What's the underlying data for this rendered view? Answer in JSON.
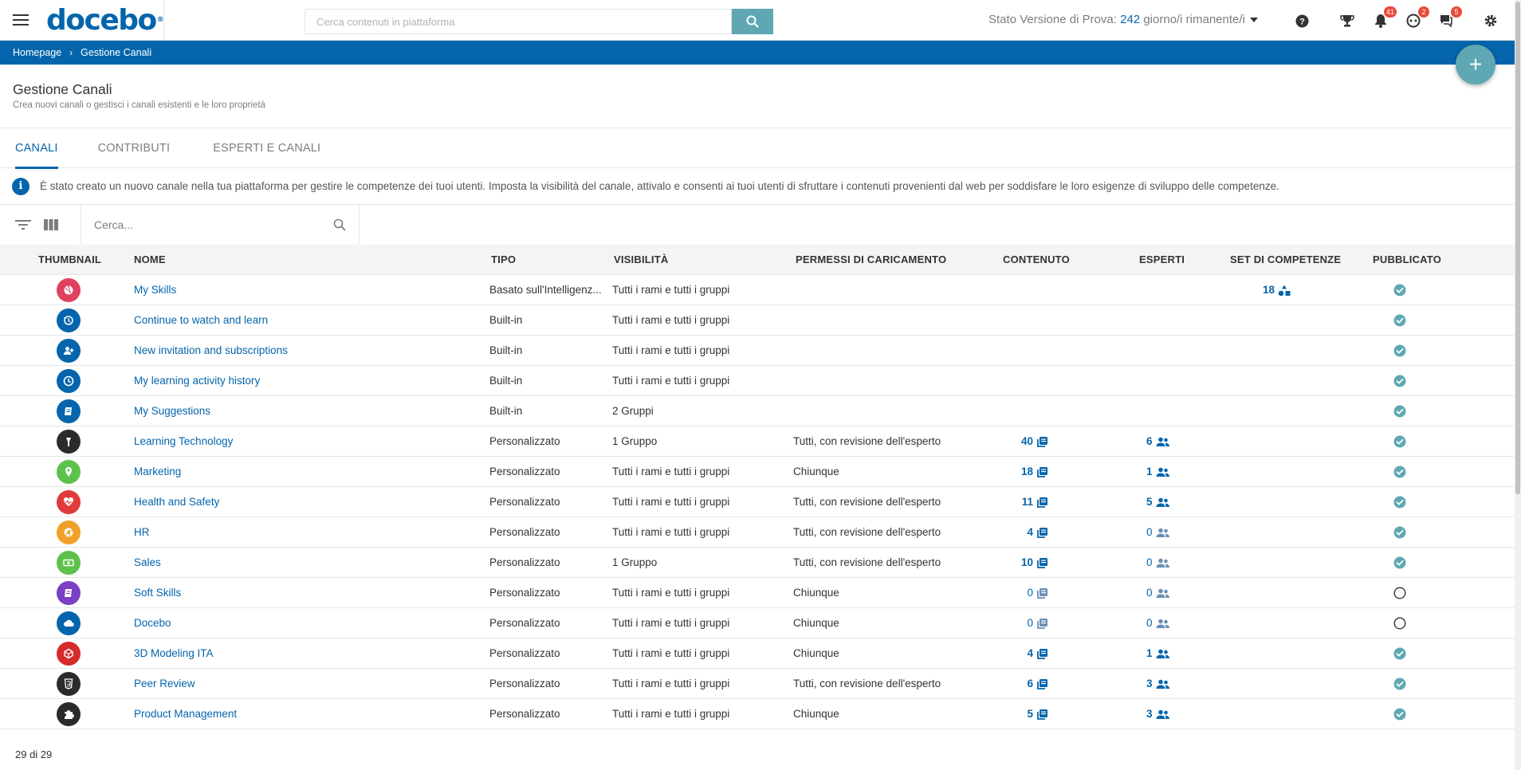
{
  "topbar": {
    "logo": "docebo",
    "search_placeholder": "Cerca contenuti in piattaforma",
    "trial_prefix": "Stato Versione di Prova:",
    "trial_days": "242",
    "trial_suffix": "giorno/i rimanente/i",
    "notifications_count": "41",
    "coach_count": "2",
    "messages_count": "5"
  },
  "breadcrumb": {
    "home": "Homepage",
    "current": "Gestione Canali"
  },
  "header": {
    "title": "Gestione Canali",
    "subtitle": "Crea nuovi canali o gestisci i canali esistenti e le loro proprietà"
  },
  "tabs": [
    {
      "label": "CANALI",
      "active": true
    },
    {
      "label": "CONTRIBUTI",
      "active": false
    },
    {
      "label": "ESPERTI E CANALI",
      "active": false
    }
  ],
  "info_message": "È stato creato un nuovo canale nella tua piattaforma per gestire le competenze dei tuoi utenti. Imposta la visibilità del canale, attivalo e consenti ai tuoi utenti di sfruttare i contenuti provenienti dal web per soddisfare le loro esigenze di sviluppo delle competenze.",
  "toolbar": {
    "search_placeholder": "Cerca..."
  },
  "table": {
    "columns": {
      "thumbnail": "THUMBNAIL",
      "name": "NOME",
      "type": "TIPO",
      "visibility": "VISIBILITÀ",
      "upload": "PERMESSI DI CARICAMENTO",
      "content": "CONTENUTO",
      "experts": "ESPERTI",
      "skills": "SET DI COMPETENZE",
      "published": "PUBBLICATO"
    },
    "rows": [
      {
        "name": "My Skills",
        "type": "Basato sull'Intelligenz...",
        "visibility": "Tutti i rami e tutti i gruppi",
        "upload": "",
        "content": "",
        "experts": "",
        "skills": "18",
        "published": true,
        "color": "#e0415e",
        "icon": "globe-icon"
      },
      {
        "name": "Continue to watch and learn",
        "type": "Built-in",
        "visibility": "Tutti i rami e tutti i gruppi",
        "upload": "",
        "content": "",
        "experts": "",
        "skills": "",
        "published": true,
        "color": "#0465ac",
        "icon": "history-icon"
      },
      {
        "name": "New invitation and subscriptions",
        "type": "Built-in",
        "visibility": "Tutti i rami e tutti i gruppi",
        "upload": "",
        "content": "",
        "experts": "",
        "skills": "",
        "published": true,
        "color": "#0465ac",
        "icon": "user-add-icon"
      },
      {
        "name": "My learning activity history",
        "type": "Built-in",
        "visibility": "Tutti i rami e tutti i gruppi",
        "upload": "",
        "content": "",
        "experts": "",
        "skills": "",
        "published": true,
        "color": "#0465ac",
        "icon": "clock-icon"
      },
      {
        "name": "My Suggestions",
        "type": "Built-in",
        "visibility": "2 Gruppi",
        "upload": "",
        "content": "",
        "experts": "",
        "skills": "",
        "published": true,
        "color": "#0465ac",
        "icon": "book-icon"
      },
      {
        "name": "Learning Technology",
        "type": "Personalizzato",
        "visibility": "1 Gruppo",
        "upload": "Tutti, con revisione dell'esperto",
        "content": "40",
        "experts": "6",
        "skills": "",
        "published": true,
        "color": "#2b2b2b",
        "icon": "torch-icon"
      },
      {
        "name": "Marketing",
        "type": "Personalizzato",
        "visibility": "Tutti i rami e tutti i gruppi",
        "upload": "Chiunque",
        "content": "18",
        "experts": "1",
        "skills": "",
        "published": true,
        "color": "#5dc24a",
        "icon": "location-icon"
      },
      {
        "name": "Health and Safety",
        "type": "Personalizzato",
        "visibility": "Tutti i rami e tutti i gruppi",
        "upload": "Tutti, con revisione dell'esperto",
        "content": "11",
        "experts": "5",
        "skills": "",
        "published": true,
        "color": "#e03a3a",
        "icon": "heart-icon"
      },
      {
        "name": "HR",
        "type": "Personalizzato",
        "visibility": "Tutti i rami e tutti i gruppi",
        "upload": "Tutti, con revisione dell'esperto",
        "content": "4",
        "experts": "0",
        "skills": "",
        "published": true,
        "color": "#f0a02a",
        "icon": "chrome-icon"
      },
      {
        "name": "Sales",
        "type": "Personalizzato",
        "visibility": "1 Gruppo",
        "upload": "Tutti, con revisione dell'esperto",
        "content": "10",
        "experts": "0",
        "skills": "",
        "published": true,
        "color": "#5dc24a",
        "icon": "money-icon"
      },
      {
        "name": "Soft Skills",
        "type": "Personalizzato",
        "visibility": "Tutti i rami e tutti i gruppi",
        "upload": "Chiunque",
        "content": "0",
        "experts": "0",
        "skills": "",
        "published": false,
        "color": "#7b3fc4",
        "icon": "book-icon"
      },
      {
        "name": "Docebo",
        "type": "Personalizzato",
        "visibility": "Tutti i rami e tutti i gruppi",
        "upload": "Chiunque",
        "content": "0",
        "experts": "0",
        "skills": "",
        "published": false,
        "color": "#0465ac",
        "icon": "cloud-icon"
      },
      {
        "name": "3D Modeling ITA",
        "type": "Personalizzato",
        "visibility": "Tutti i rami e tutti i gruppi",
        "upload": "Chiunque",
        "content": "4",
        "experts": "1",
        "skills": "",
        "published": true,
        "color": "#d52b2b",
        "icon": "cube-icon"
      },
      {
        "name": "Peer Review",
        "type": "Personalizzato",
        "visibility": "Tutti i rami e tutti i gruppi",
        "upload": "Tutti, con revisione dell'esperto",
        "content": "6",
        "experts": "3",
        "skills": "",
        "published": true,
        "color": "#2b2b2b",
        "icon": "html5-icon"
      },
      {
        "name": "Product Management",
        "type": "Personalizzato",
        "visibility": "Tutti i rami e tutti i gruppi",
        "upload": "Chiunque",
        "content": "5",
        "experts": "3",
        "skills": "",
        "published": true,
        "color": "#2b2b2b",
        "icon": "puzzle-icon"
      }
    ]
  },
  "footer": {
    "count": "29 di 29"
  },
  "colors": {
    "brand_blue": "#0465ac",
    "accent_teal": "#5fa8b3",
    "badge_red": "#e84a3a"
  }
}
